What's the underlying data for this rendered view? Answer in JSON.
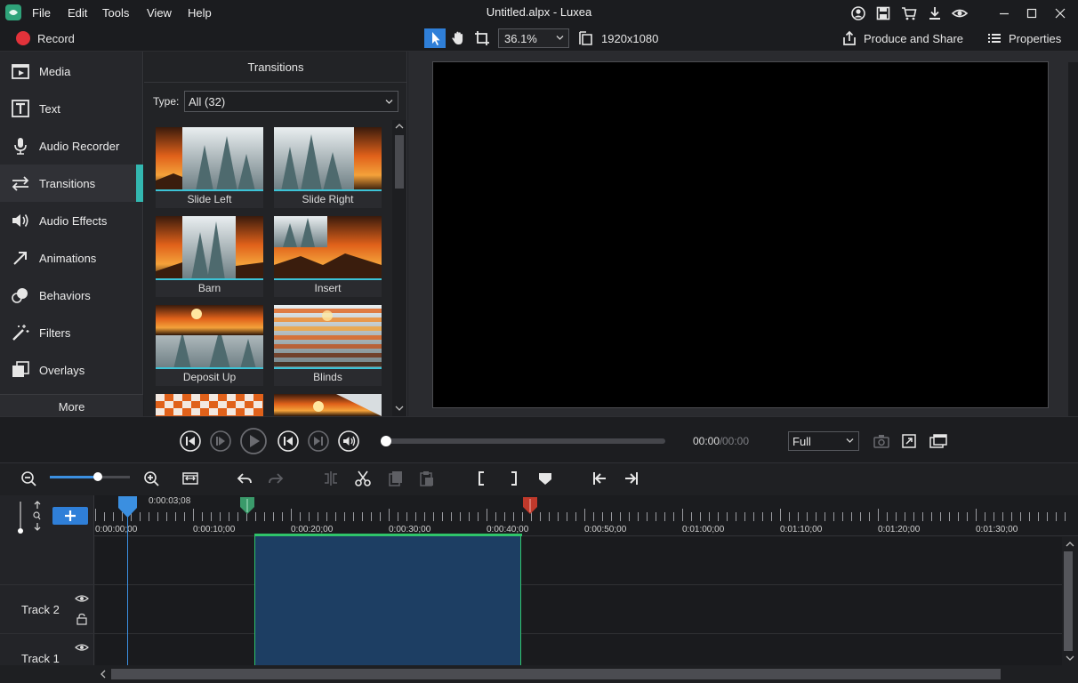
{
  "window": {
    "title": "Untitled.alpx - Luxea",
    "menu": [
      "File",
      "Edit",
      "Tools",
      "View",
      "Help"
    ]
  },
  "toolbar": {
    "record_label": "Record",
    "zoom_value": "36.1%",
    "resolution": "1920x1080",
    "produce_label": "Produce and Share",
    "properties_label": "Properties"
  },
  "sidebar": {
    "items": [
      {
        "label": "Media",
        "icon": "media-icon"
      },
      {
        "label": "Text",
        "icon": "text-icon"
      },
      {
        "label": "Audio Recorder",
        "icon": "microphone-icon"
      },
      {
        "label": "Transitions",
        "icon": "transitions-icon",
        "active": true
      },
      {
        "label": "Audio Effects",
        "icon": "speaker-icon"
      },
      {
        "label": "Animations",
        "icon": "arrow-icon"
      },
      {
        "label": "Behaviors",
        "icon": "behaviors-icon"
      },
      {
        "label": "Filters",
        "icon": "magic-wand-icon"
      },
      {
        "label": "Overlays",
        "icon": "overlays-icon"
      }
    ],
    "more_label": "More"
  },
  "transitions": {
    "title": "Transitions",
    "type_label": "Type:",
    "type_value": "All (32)",
    "items": [
      "Slide Left",
      "Slide Right",
      "Barn",
      "Insert",
      "Deposit Up",
      "Blinds"
    ]
  },
  "player": {
    "time_current": "00:00",
    "time_separator": "/",
    "time_total": "00:00",
    "view_mode": "Full"
  },
  "timeline": {
    "playhead_time": "0:00:03;08",
    "ticks": [
      "0:00:00;00",
      "0:00:10;00",
      "0:00:20;00",
      "0:00:30;00",
      "0:00:40;00",
      "0:00:50;00",
      "0:01:00;00",
      "0:01:10;00",
      "0:01:20;00",
      "0:01:30;00"
    ],
    "tracks": [
      "Track 2",
      "Track 1"
    ]
  },
  "colors": {
    "accent": "#33b7b0",
    "record": "#e2323a",
    "selection": "#1d3e63",
    "in_marker": "#3a9a6a",
    "out_marker": "#c0392b",
    "playhead": "#3b8fe0"
  }
}
